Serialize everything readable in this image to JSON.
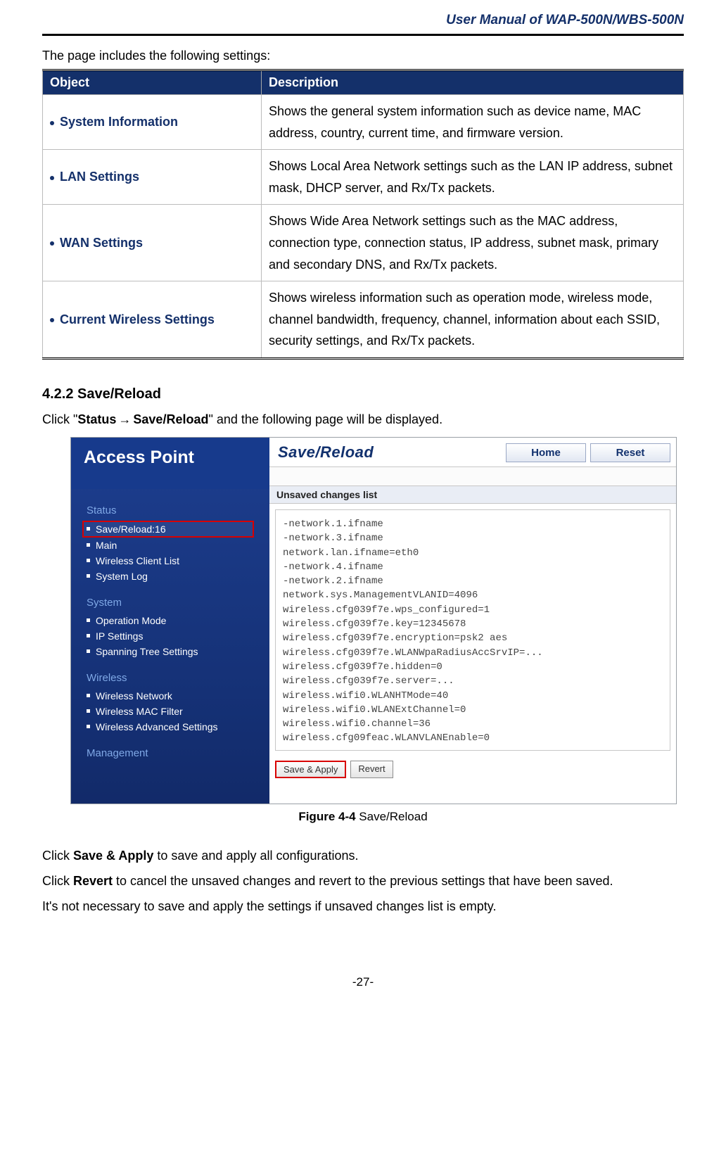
{
  "header": {
    "title": "User  Manual  of  WAP-500N/WBS-500N"
  },
  "intro": "The page includes the following settings:",
  "table": {
    "head": {
      "col1": "Object",
      "col2": "Description"
    },
    "rows": [
      {
        "obj": "System Information",
        "desc": "Shows the general system information such as device name, MAC address, country, current time, and firmware version."
      },
      {
        "obj": "LAN Settings",
        "desc": "Shows Local Area Network settings such as the LAN IP address, subnet mask, DHCP server, and Rx/Tx packets."
      },
      {
        "obj": "WAN Settings",
        "desc": "Shows Wide Area Network settings such as the MAC address, connection type, connection status, IP address, subnet mask, primary and secondary DNS, and Rx/Tx packets."
      },
      {
        "obj": "Current Wireless Settings",
        "desc": "Shows wireless information such as operation mode, wireless mode, channel bandwidth, frequency, channel, information about each SSID, security settings, and Rx/Tx packets."
      }
    ]
  },
  "section": {
    "num_title": "4.2.2   Save/Reload"
  },
  "navtext": {
    "pre": "Click \"",
    "b1": "Status",
    "b2": "Save/Reload",
    "post": "\" and the following page will be displayed."
  },
  "figure": {
    "side": {
      "brand": "Access Point",
      "groups": [
        {
          "name": "Status",
          "items": [
            {
              "label": "Save/Reload:16",
              "selected": true
            },
            {
              "label": "Main"
            },
            {
              "label": "Wireless Client List"
            },
            {
              "label": "System Log"
            }
          ]
        },
        {
          "name": "System",
          "items": [
            {
              "label": "Operation Mode"
            },
            {
              "label": "IP Settings"
            },
            {
              "label": "Spanning Tree Settings"
            }
          ]
        },
        {
          "name": "Wireless",
          "items": [
            {
              "label": "Wireless Network"
            },
            {
              "label": "Wireless MAC Filter"
            },
            {
              "label": "Wireless Advanced Settings"
            }
          ]
        },
        {
          "name": "Management",
          "items": []
        }
      ]
    },
    "main": {
      "title": "Save/Reload",
      "btn_home": "Home",
      "btn_reset": "Reset",
      "list_header": "Unsaved changes list",
      "changes_text": "-network.1.ifname\n-network.3.ifname\nnetwork.lan.ifname=eth0\n-network.4.ifname\n-network.2.ifname\nnetwork.sys.ManagementVLANID=4096\nwireless.cfg039f7e.wps_configured=1\nwireless.cfg039f7e.key=12345678\nwireless.cfg039f7e.encryption=psk2 aes\nwireless.cfg039f7e.WLANWpaRadiusAccSrvIP=...\nwireless.cfg039f7e.hidden=0\nwireless.cfg039f7e.server=...\nwireless.wifi0.WLANHTMode=40\nwireless.wifi0.WLANExtChannel=0\nwireless.wifi0.channel=36\nwireless.cfg09feac.WLANVLANEnable=0",
      "btn_save": "Save & Apply",
      "btn_revert": "Revert"
    },
    "caption_bold": "Figure 4-4",
    "caption_rest": " Save/Reload"
  },
  "after": {
    "p1a": "Click ",
    "p1b": "Save & Apply",
    "p1c": " to save and apply all configurations.",
    "p2a": "Click ",
    "p2b": "Revert",
    "p2c": " to cancel the unsaved changes and revert to the previous settings that have been saved.",
    "p3": "It's not necessary to save and apply the settings if unsaved changes list is empty."
  },
  "footer": {
    "page": "-27-"
  }
}
